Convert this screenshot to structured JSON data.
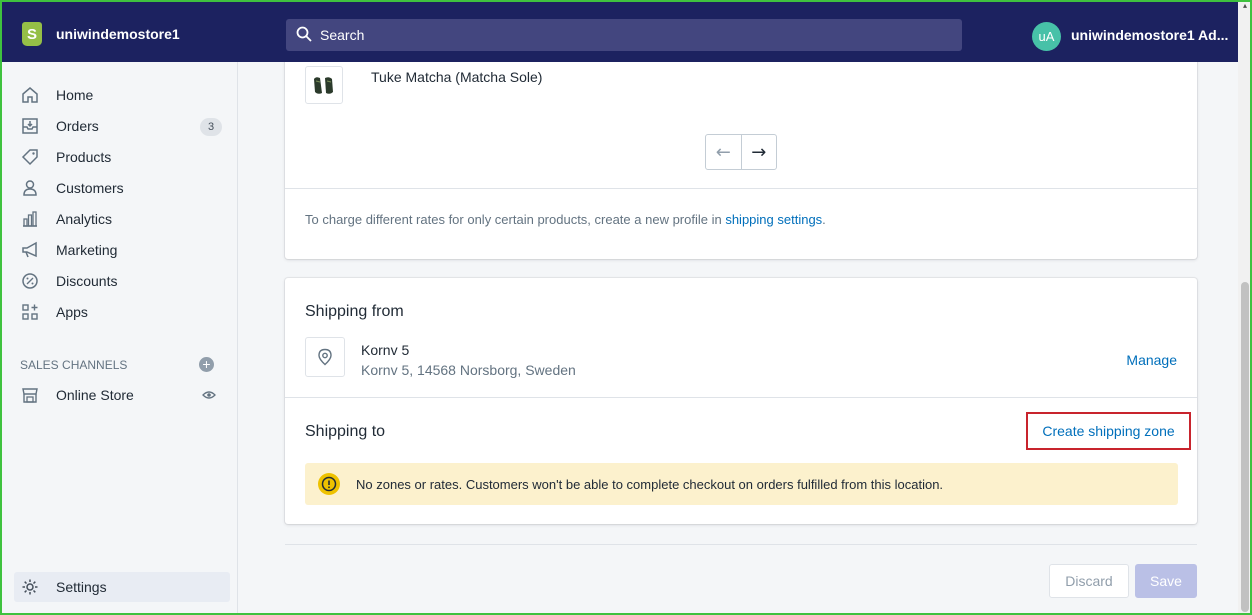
{
  "topbar": {
    "store_name": "uniwindemostore1",
    "search_placeholder": "Search",
    "avatar_initials": "uA",
    "account_name": "uniwindemostore1 Ad..."
  },
  "sidebar": {
    "items": [
      {
        "label": "Home",
        "icon": "home-icon"
      },
      {
        "label": "Orders",
        "icon": "orders-icon",
        "badge": "3"
      },
      {
        "label": "Products",
        "icon": "tag-icon"
      },
      {
        "label": "Customers",
        "icon": "person-icon"
      },
      {
        "label": "Analytics",
        "icon": "bar-chart-icon"
      },
      {
        "label": "Marketing",
        "icon": "megaphone-icon"
      },
      {
        "label": "Discounts",
        "icon": "discount-icon"
      },
      {
        "label": "Apps",
        "icon": "apps-icon"
      }
    ],
    "channels_heading": "SALES CHANNELS",
    "online_store_label": "Online Store",
    "settings_label": "Settings"
  },
  "products_card": {
    "product_name": "Tuke Matcha (Matcha Sole)",
    "prev_arrow": "←",
    "next_arrow": "→",
    "note_text": "To charge different rates for only certain products, create a new profile in ",
    "note_link": "shipping settings",
    "note_end": "."
  },
  "shipping_card": {
    "from_title": "Shipping from",
    "location_name": "Kornv 5",
    "location_address": "Kornv 5, 14568 Norsborg, Sweden",
    "manage_label": "Manage",
    "to_title": "Shipping to",
    "create_zone_label": "Create shipping zone",
    "warning_message": "No zones or rates. Customers won't be able to complete checkout on orders fulfilled from this location."
  },
  "footer": {
    "discard_label": "Discard",
    "save_label": "Save"
  },
  "colors": {
    "topbar": "#1c2260",
    "link": "#006fbb",
    "highlight_border": "#c8242d",
    "warning_bg": "#fcf1cd"
  }
}
